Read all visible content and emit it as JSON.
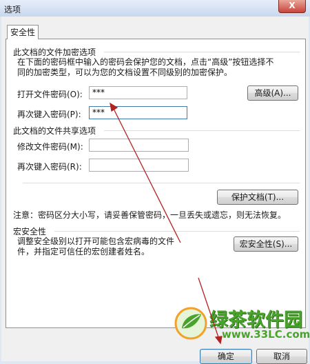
{
  "window": {
    "title": "选项",
    "close_symbol": "X"
  },
  "tabs": [
    {
      "label": "安全性"
    }
  ],
  "encryption": {
    "title": "此文档的文件加密选项",
    "desc_line1": "在下面的密码框中输入的密码会保护您的文档，点击“高级”按钮选择不",
    "desc_line2": "同的加密类型，可以为您的文档设置不同级别的加密保护。",
    "open_label": "打开文件密码(O):",
    "open_value": "***",
    "reenter_label": "再次键入密码(P):",
    "reenter_value": "***",
    "advanced_button": "高级(A)..."
  },
  "sharing": {
    "title": "此文档的文件共享选项",
    "modify_label": "修改文件密码(M):",
    "modify_value": "",
    "reenter_label": "再次键入密码(R):",
    "reenter_value": "",
    "protect_button": "保护文档(T)..."
  },
  "note": "注意：密码区分大小写，请妥善保管密码，一旦丢失或遗忘，则无法恢复。",
  "macro": {
    "title": "宏安全性",
    "desc_line1": "调整安全级别以打开可能包含宏病毒的文件",
    "desc_line2": "件，并指定可信任的宏创建者姓名。",
    "button": "宏安全性(S)..."
  },
  "footer": {
    "ok_button": "确定",
    "cancel_button": "取消"
  },
  "watermark": {
    "site_name": "绿茶软件园",
    "url": "www.33LC.com"
  },
  "annotations": {
    "color": "#b22222"
  }
}
